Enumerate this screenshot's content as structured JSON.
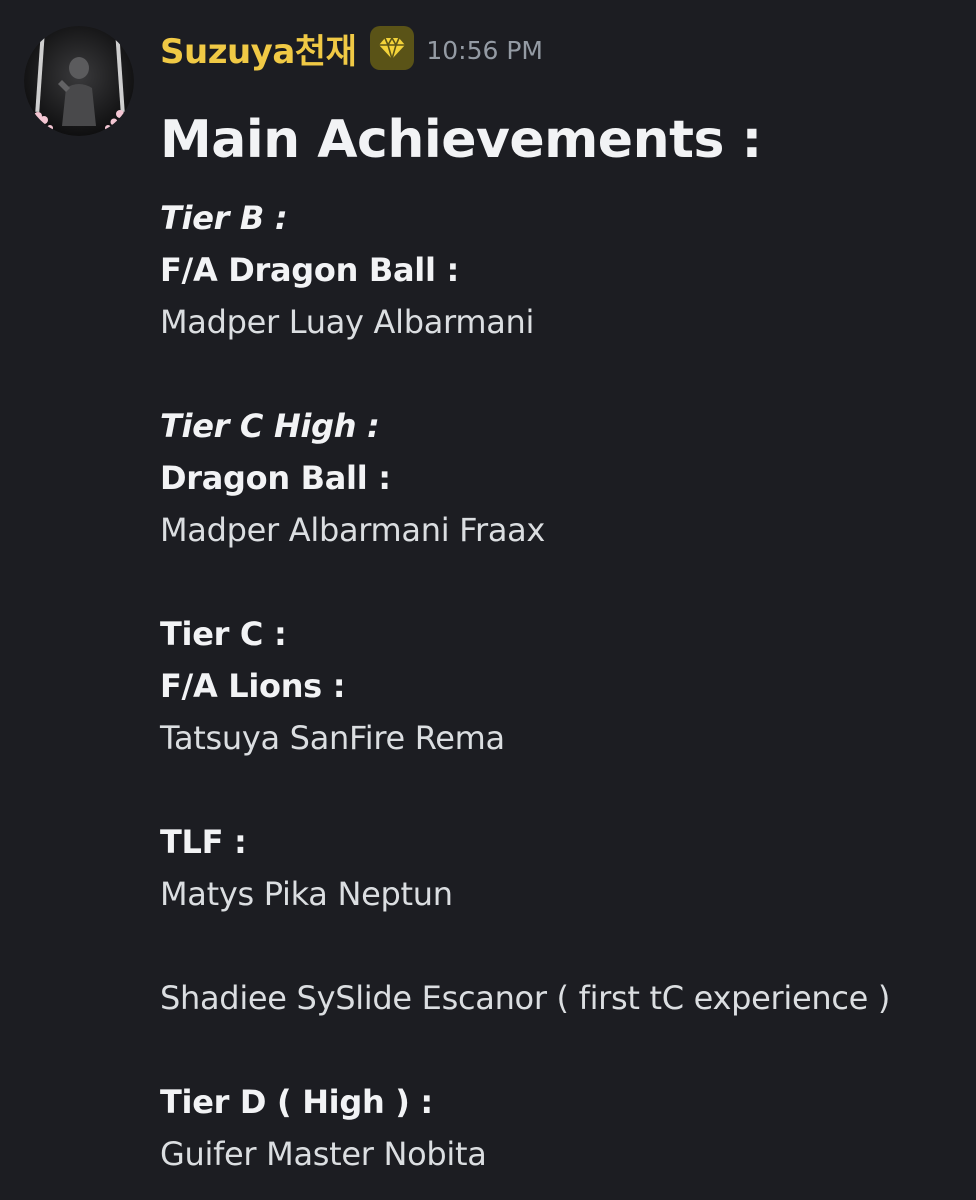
{
  "author": {
    "username": "Suzuya천재",
    "badge_icon": "gem-icon",
    "timestamp": "10:56 PM"
  },
  "colors": {
    "background": "#1c1d22",
    "username": "#f0c945",
    "badge_bg": "#5a5317",
    "badge_gem": "#f3d33a",
    "timestamp": "#949ba4",
    "text": "#dbdee1",
    "heading": "#f2f3f5"
  },
  "message": {
    "heading": "Main Achievements :",
    "sections": [
      {
        "tier": "Tier B :",
        "team": "F/A Dragon Ball :",
        "members": "Madper Luay Albarmani"
      },
      {
        "tier": "Tier C High :",
        "team": "Dragon Ball :",
        "members": "Madper Albarmani Fraax"
      },
      {
        "tier": "Tier C :",
        "team": "F/A Lions :",
        "members": "Tatsuya SanFire Rema"
      },
      {
        "team": "TLF :",
        "members": "Matys Pika Neptun"
      },
      {
        "members": "Shadiee SySlide Escanor ( first tC experience )"
      },
      {
        "tier": "Tier D ( High ) :",
        "members": "Guifer Master Nobita"
      }
    ]
  }
}
